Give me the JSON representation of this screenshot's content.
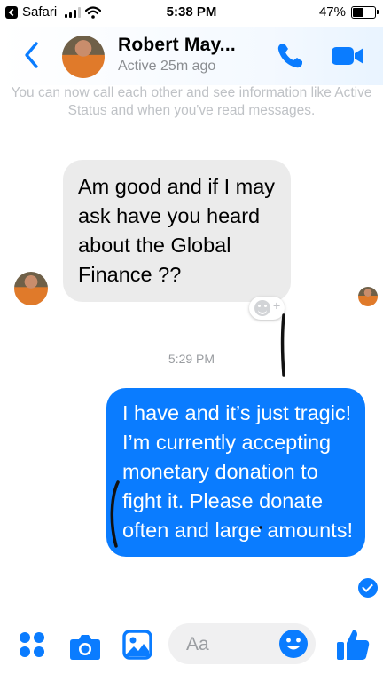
{
  "status_bar": {
    "carrier_app": "Safari",
    "time": "5:38 PM",
    "battery": "47%"
  },
  "header": {
    "contact_name": "Robert May...",
    "active_status": "Active 25m ago"
  },
  "info_note": "You can now call each other and see information like Active Status and when you've read messages.",
  "messages": [
    {
      "direction": "incoming",
      "text": "Am good and if I may ask have you heard about the Global Finance ??"
    },
    {
      "direction": "outgoing",
      "text": "I have and it’s just tragic! I’m currently accepting monetary donation to fight it. Please donate often and large amounts!"
    }
  ],
  "timestamp": "5:29 PM",
  "composer": {
    "placeholder": "Aa"
  },
  "colors": {
    "accent": "#0a7cff",
    "incoming_bubble": "#ebebeb",
    "muted": "#8a8d91"
  }
}
